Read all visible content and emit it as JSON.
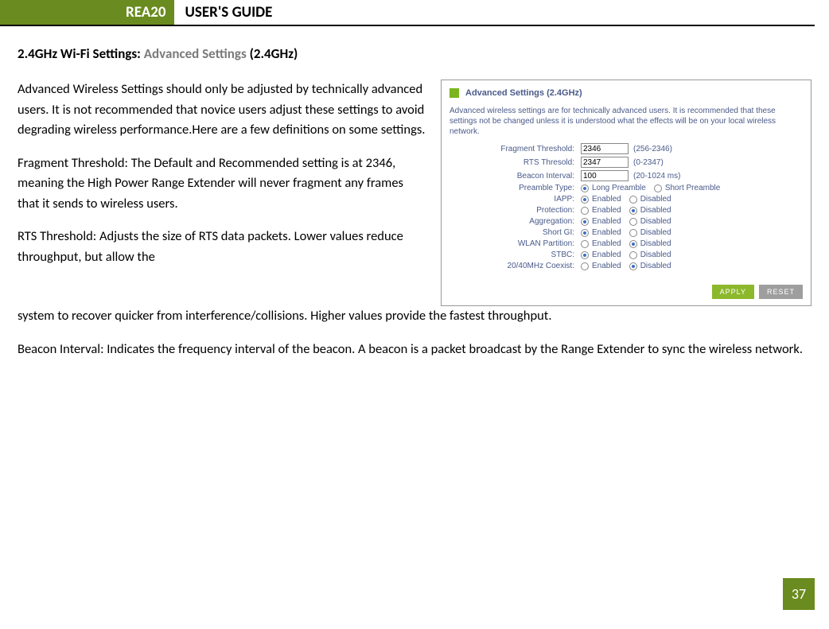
{
  "header": {
    "badge": "REA20",
    "title": "USER'S GUIDE"
  },
  "section": {
    "prefix": "2.4GHz Wi-Fi Settings: ",
    "gray": "Advanced Settings ",
    "suffix": "(2.4GHz)"
  },
  "paragraphs": {
    "p1": "Advanced Wireless Settings should only be adjusted by technically advanced users. It is not recommended that novice users adjust these settings to avoid degrading wireless performance.Here are a few definitions on some settings.",
    "p2": "Fragment Threshold: The Default and Recommended setting is at 2346, meaning the High Power Range Extender will never fragment any frames that it sends to wireless users.",
    "p3a": "RTS Threshold: Adjusts the size of RTS data packets. Lower values reduce throughput, but allow the",
    "p3b": "system to recover quicker from interference/collisions. Higher values provide the fastest throughput.",
    "p4": "Beacon Interval: Indicates the frequency interval of the beacon. A beacon is a packet broadcast by the Range Extender to sync the wireless network."
  },
  "screenshot": {
    "title": "Advanced Settings (2.4GHz)",
    "desc": "Advanced wireless settings are for technically advanced users. It is recommended that these settings not be changed unless it is understood what the effects will be on your local wireless network.",
    "rows": {
      "frag": {
        "label": "Fragment Threshold:",
        "value": "2346",
        "hint": "(256-2346)"
      },
      "rts": {
        "label": "RTS Thresold:",
        "value": "2347",
        "hint": "(0-2347)"
      },
      "beacon": {
        "label": "Beacon Interval:",
        "value": "100",
        "hint": "(20-1024 ms)"
      },
      "preamble": {
        "label": "Preamble Type:",
        "opt1": "Long Preamble",
        "opt2": "Short Preamble"
      },
      "iapp": {
        "label": "IAPP:",
        "opt1": "Enabled",
        "opt2": "Disabled"
      },
      "protection": {
        "label": "Protection:",
        "opt1": "Enabled",
        "opt2": "Disabled"
      },
      "aggregation": {
        "label": "Aggregation:",
        "opt1": "Enabled",
        "opt2": "Disabled"
      },
      "shortgi": {
        "label": "Short GI:",
        "opt1": "Enabled",
        "opt2": "Disabled"
      },
      "wlan": {
        "label": "WLAN Partition:",
        "opt1": "Enabled",
        "opt2": "Disabled"
      },
      "stbc": {
        "label": "STBC:",
        "opt1": "Enabled",
        "opt2": "Disabled"
      },
      "coexist": {
        "label": "20/40MHz Coexist:",
        "opt1": "Enabled",
        "opt2": "Disabled"
      }
    },
    "buttons": {
      "apply": "APPLY",
      "reset": "RESET"
    }
  },
  "page": "37"
}
